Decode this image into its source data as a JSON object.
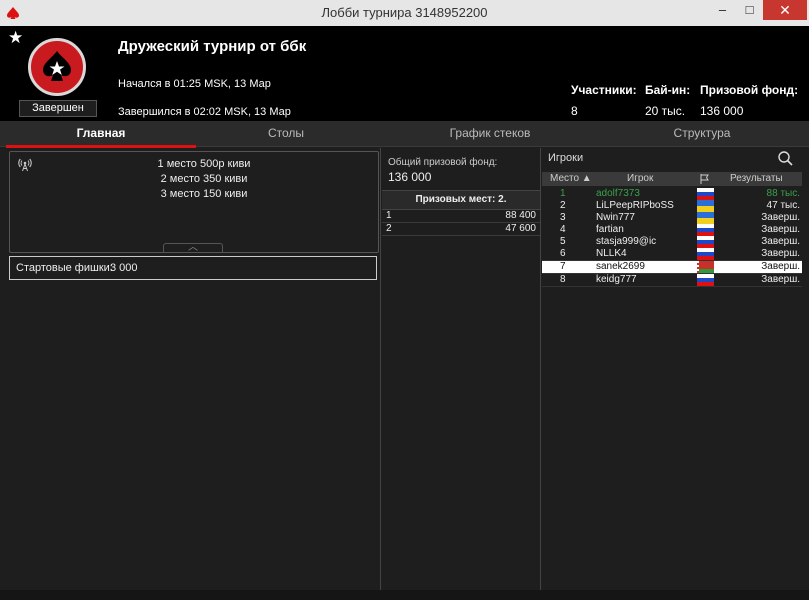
{
  "window": {
    "title": "Лобби турнира 3148952200",
    "min": "–",
    "max": "□",
    "close": "✕"
  },
  "tournament": {
    "name": "Дружеский турнир от ббк",
    "status": "Завершен",
    "started": "Начался в 01:25 MSK, 13 Мар",
    "ended": "Завершился в 02:02 MSK, 13 Мар",
    "players_label": "Участники:",
    "players": "8",
    "buyin_label": "Бай-ин:",
    "buyin": "20 тыс.",
    "prizepool_label": "Призовой фонд:",
    "prizepool": "136 000"
  },
  "tabs": [
    {
      "label": "Главная",
      "active": true
    },
    {
      "label": "Столы"
    },
    {
      "label": "График стеков"
    },
    {
      "label": "Структура"
    }
  ],
  "main": {
    "prize_lines": [
      "1 место 500р киви",
      "2 место 350 киви",
      "3 место 150 киви"
    ],
    "starting_chips_label": "Стартовые фишки:",
    "starting_chips": "3 000"
  },
  "prizes": {
    "pool_label": "Общий призовой фонд:",
    "pool_value": "136 000",
    "paid_places": "Призовых мест: 2.",
    "rows": [
      {
        "place": "1",
        "amount": "88 400"
      },
      {
        "place": "2",
        "amount": "47 600"
      }
    ]
  },
  "players": {
    "search_label": "Игроки",
    "headers": {
      "place": "Место ▲",
      "player": "Игрок",
      "results": "Результаты"
    },
    "rows": [
      {
        "place": "1",
        "name": "adolf7373",
        "flag": "ru",
        "result": "88 тыс."
      },
      {
        "place": "2",
        "name": "LiLPeepRIPboSS",
        "flag": "ua",
        "result": "47 тыс."
      },
      {
        "place": "3",
        "name": "Nwin777",
        "flag": "ua",
        "result": "Заверш."
      },
      {
        "place": "4",
        "name": "fartian",
        "flag": "ru",
        "result": "Заверш."
      },
      {
        "place": "5",
        "name": "stasja999@ic",
        "flag": "ru",
        "result": "Заверш."
      },
      {
        "place": "6",
        "name": "NLLK4",
        "flag": "ru",
        "result": "Заверш."
      },
      {
        "place": "7",
        "name": "sanek2699",
        "flag": "by",
        "result": "Заверш."
      },
      {
        "place": "8",
        "name": "keidg777",
        "flag": "ru",
        "result": "Заверш."
      }
    ]
  }
}
